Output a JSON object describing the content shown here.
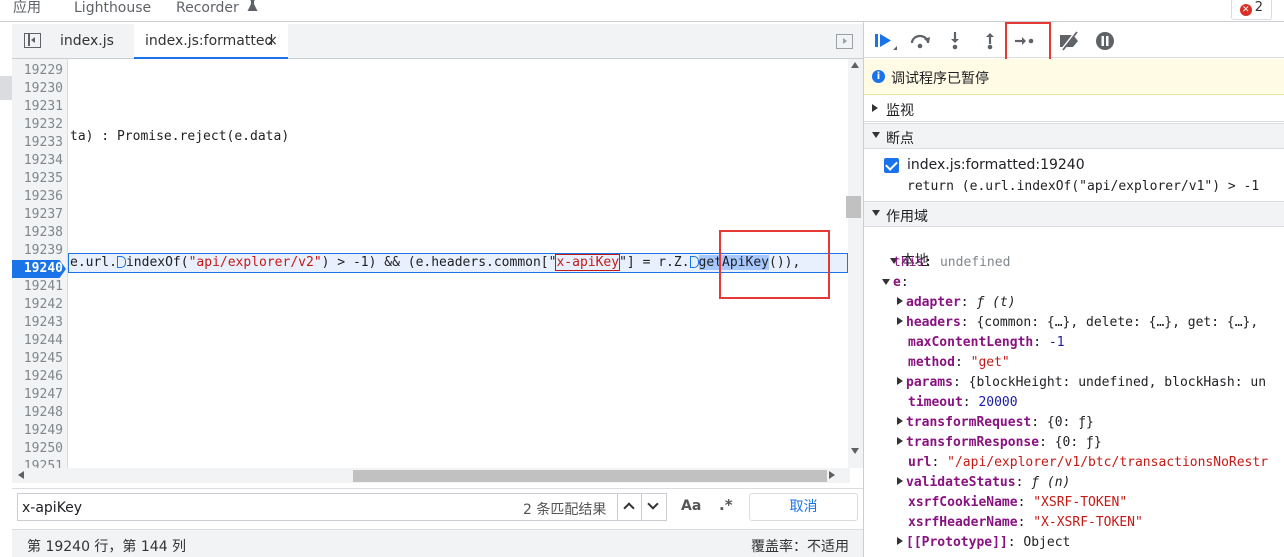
{
  "top_tabs": [
    "应用",
    "Lighthouse",
    "Recorder"
  ],
  "error_badge": {
    "count": "2"
  },
  "editor_tabs": {
    "tab1": "index.js",
    "tab2": "index.js:formatted",
    "close": "×"
  },
  "code": {
    "line_numbers": [
      "19229",
      "19230",
      "19231",
      "19232",
      "19233",
      "19234",
      "19235",
      "19236",
      "19237",
      "19238",
      "19239",
      "19240",
      "19241",
      "19242",
      "19243",
      "19244",
      "19245",
      "19246",
      "19247",
      "19248",
      "19249",
      "19250",
      "19251"
    ],
    "current_line": "19240",
    "line_19233": "ta) : Promise.reject(e.data)",
    "exec_parts": {
      "p1": "e.url.",
      "p2": "indexOf(",
      "p3": "\"api/explorer/v2\"",
      "p4": ") > -1) && (e.headers.common[\"",
      "p5": "x-apiKey",
      "p6": "\"] = r.Z.",
      "p7": "getApiKey",
      "p8": "()),"
    }
  },
  "search": {
    "value": "x-apiKey",
    "match_count": "2 条匹配结果",
    "case_label": "Aa",
    "regex_label": ".*",
    "cancel": "取消"
  },
  "status": {
    "cursor": "第 19240 行，第 144 列",
    "coverage": "覆盖率：不适用"
  },
  "debugger": {
    "paused_message": "调试程序已暂停",
    "sections": {
      "watch": "监视",
      "breakpoints": "断点",
      "scope": "作用域"
    },
    "breakpoint": {
      "location": "index.js:formatted:19240",
      "code": "return (e.url.indexOf(\"api/explorer/v1\") > -1"
    },
    "scope_local": "本地",
    "scope_rows": [
      {
        "key": "this",
        "sep": ": ",
        "val": "undefined",
        "vtype": "undef",
        "arrow": "none",
        "indent": 1
      },
      {
        "key": "e",
        "sep": ":",
        "val": "",
        "vtype": "obj",
        "arrow": "down",
        "indent": 1
      },
      {
        "key": "adapter",
        "sep": ": ",
        "val": "ƒ (t)",
        "vtype": "fn",
        "arrow": "right",
        "indent": 2
      },
      {
        "key": "headers",
        "sep": ": ",
        "val": "{common: {…}, delete: {…}, get: {…},",
        "vtype": "obj",
        "arrow": "right",
        "indent": 2
      },
      {
        "key": "maxContentLength",
        "sep": ": ",
        "val": "-1",
        "vtype": "num",
        "arrow": "none",
        "indent": 2
      },
      {
        "key": "method",
        "sep": ": ",
        "val": "\"get\"",
        "vtype": "str",
        "arrow": "none",
        "indent": 2
      },
      {
        "key": "params",
        "sep": ": ",
        "val": "{blockHeight: undefined, blockHash: un",
        "vtype": "obj",
        "arrow": "right",
        "indent": 2
      },
      {
        "key": "timeout",
        "sep": ": ",
        "val": "20000",
        "vtype": "num",
        "arrow": "none",
        "indent": 2
      },
      {
        "key": "transformRequest",
        "sep": ": ",
        "val": "{0: ƒ}",
        "vtype": "obj",
        "arrow": "right",
        "indent": 2
      },
      {
        "key": "transformResponse",
        "sep": ": ",
        "val": "{0: ƒ}",
        "vtype": "obj",
        "arrow": "right",
        "indent": 2
      },
      {
        "key": "url",
        "sep": ": ",
        "val": "\"/api/explorer/v1/btc/transactionsNoRestr",
        "vtype": "str",
        "arrow": "none",
        "indent": 2
      },
      {
        "key": "validateStatus",
        "sep": ": ",
        "val": "ƒ (n)",
        "vtype": "fn",
        "arrow": "right",
        "indent": 2
      },
      {
        "key": "xsrfCookieName",
        "sep": ": ",
        "val": "\"XSRF-TOKEN\"",
        "vtype": "str",
        "arrow": "none",
        "indent": 2
      },
      {
        "key": "xsrfHeaderName",
        "sep": ": ",
        "val": "\"X-XSRF-TOKEN\"",
        "vtype": "str",
        "arrow": "none",
        "indent": 2
      },
      {
        "key": "[[Prototype]]",
        "sep": ": ",
        "val": "Object",
        "vtype": "obj",
        "arrow": "right",
        "indent": 2
      }
    ]
  },
  "colors": {
    "accent": "#1a73e8",
    "annotation_red": "#e53935",
    "paused_bg": "#fffbe5"
  }
}
